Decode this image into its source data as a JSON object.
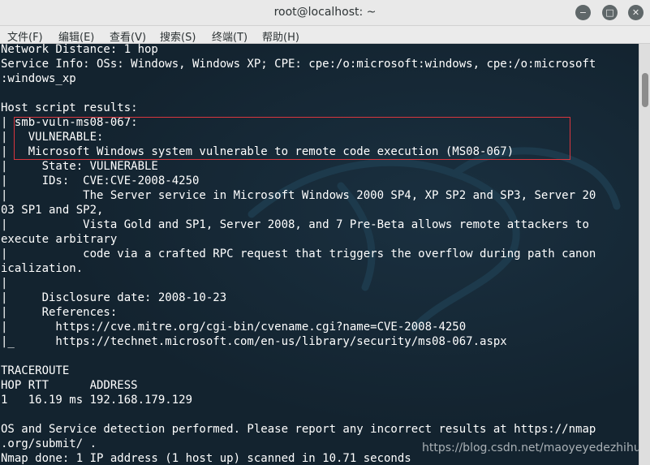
{
  "window": {
    "title": "root@localhost: ~",
    "minimize_glyph": "−",
    "maximize_glyph": "□",
    "close_glyph": "✕"
  },
  "menu": [
    "文件(F)",
    "编辑(E)",
    "查看(V)",
    "搜索(S)",
    "终端(T)",
    "帮助(H)"
  ],
  "terminal_lines": [
    "Network Distance: 1 hop",
    "Service Info: OSs: Windows, Windows XP; CPE: cpe:/o:microsoft:windows, cpe:/o:microsoft",
    ":windows_xp",
    "",
    "Host script results:",
    "| smb-vuln-ms08-067:",
    "|   VULNERABLE:",
    "|   Microsoft Windows system vulnerable to remote code execution (MS08-067)",
    "|     State: VULNERABLE",
    "|     IDs:  CVE:CVE-2008-4250",
    "|           The Server service in Microsoft Windows 2000 SP4, XP SP2 and SP3, Server 20",
    "03 SP1 and SP2,",
    "|           Vista Gold and SP1, Server 2008, and 7 Pre-Beta allows remote attackers to",
    "execute arbitrary",
    "|           code via a crafted RPC request that triggers the overflow during path canon",
    "icalization.",
    "|",
    "|     Disclosure date: 2008-10-23",
    "|     References:",
    "|       https://cve.mitre.org/cgi-bin/cvename.cgi?name=CVE-2008-4250",
    "|_      https://technet.microsoft.com/en-us/library/security/ms08-067.aspx",
    "",
    "TRACEROUTE",
    "HOP RTT      ADDRESS",
    "1   16.19 ms 192.168.179.129",
    "",
    "OS and Service detection performed. Please report any incorrect results at https://nmap",
    ".org/submit/ .",
    "Nmap done: 1 IP address (1 host up) scanned in 10.71 seconds"
  ],
  "watermark": "https://blog.csdn.net/maoyeyedezhihu"
}
